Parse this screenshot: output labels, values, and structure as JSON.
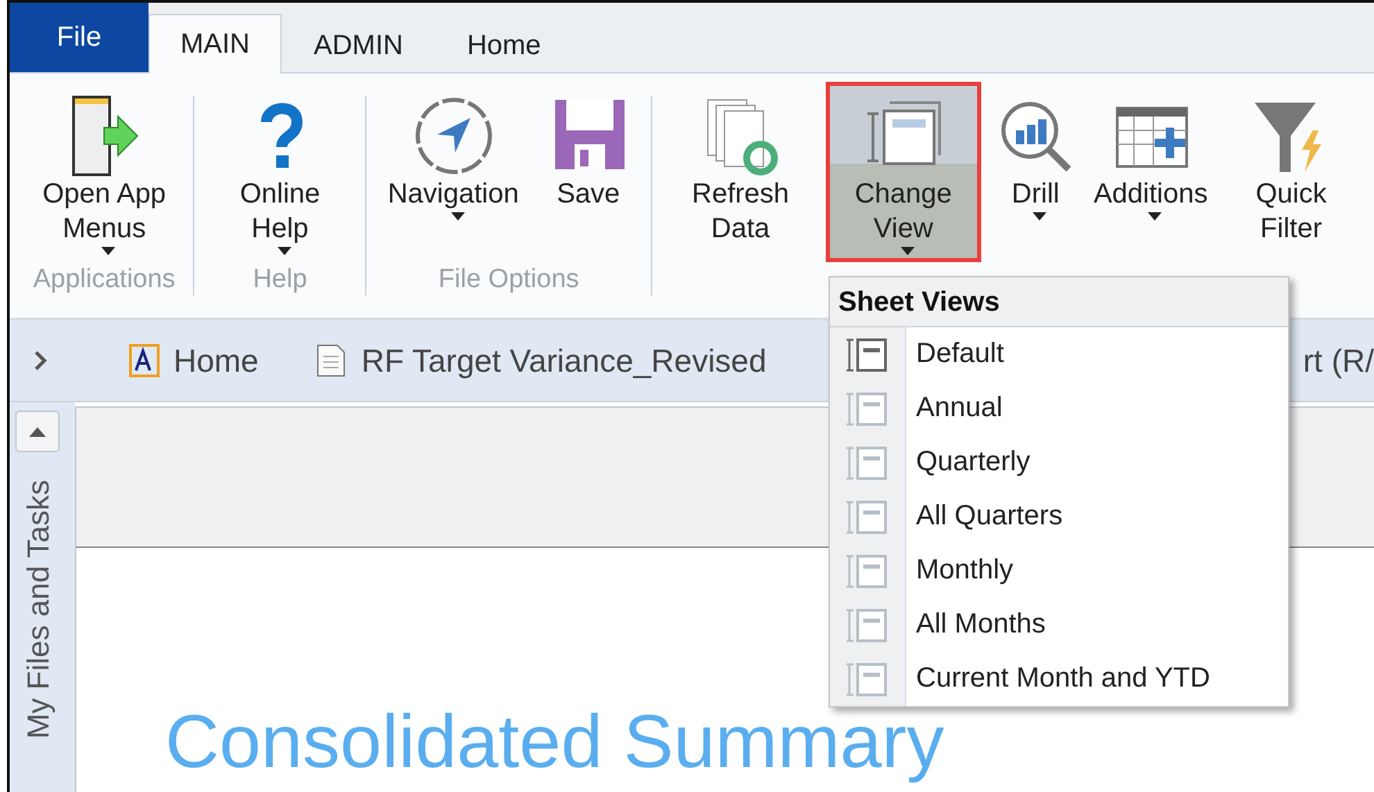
{
  "file_button": "File",
  "tabs": [
    {
      "label": "MAIN",
      "selected": true
    },
    {
      "label": "ADMIN",
      "selected": false
    },
    {
      "label": "Home",
      "selected": false
    }
  ],
  "ribbon_groups": [
    {
      "label": "Applications",
      "buttons": [
        {
          "kind": "launch",
          "label": "Open App Menus",
          "dropdown": true,
          "highlighted": false
        }
      ]
    },
    {
      "label": "Help",
      "buttons": [
        {
          "kind": "help",
          "label": "Online Help",
          "dropdown": true,
          "highlighted": false
        }
      ]
    },
    {
      "label": "File Options",
      "buttons": [
        {
          "kind": "compass",
          "label": "Navigation",
          "dropdown": true,
          "highlighted": false
        },
        {
          "kind": "save",
          "label": "Save",
          "dropdown": false,
          "highlighted": false
        }
      ]
    },
    {
      "buttons": [
        {
          "kind": "refresh",
          "label": "Refresh Data",
          "dropdown": false,
          "highlighted": false
        },
        {
          "kind": "view",
          "label": "Change View",
          "dropdown": true,
          "highlighted": true
        },
        {
          "kind": "drill",
          "label": "Drill",
          "dropdown": true,
          "highlighted": false
        },
        {
          "kind": "add",
          "label": "Additions",
          "dropdown": true,
          "highlighted": false
        },
        {
          "kind": "filter",
          "label": "Quick Filter",
          "dropdown": false,
          "highlighted": false
        }
      ]
    }
  ],
  "doc_tabs": [
    {
      "kind": "app",
      "label": "Home"
    },
    {
      "kind": "doc",
      "label": "RF Target Variance_Revised"
    },
    {
      "kind": "partial",
      "label": "rt (R/"
    }
  ],
  "side_panel": {
    "label": "My Files and Tasks"
  },
  "content": {
    "heading": "Consolidated Summary"
  },
  "menu": {
    "title": "Sheet Views",
    "items": [
      {
        "label": "Default",
        "selected": true
      },
      {
        "label": "Annual",
        "selected": false
      },
      {
        "label": "Quarterly",
        "selected": false
      },
      {
        "label": "All Quarters",
        "selected": false
      },
      {
        "label": "Monthly",
        "selected": false
      },
      {
        "label": "All Months",
        "selected": false
      },
      {
        "label": "Current Month and YTD",
        "selected": false
      }
    ]
  }
}
